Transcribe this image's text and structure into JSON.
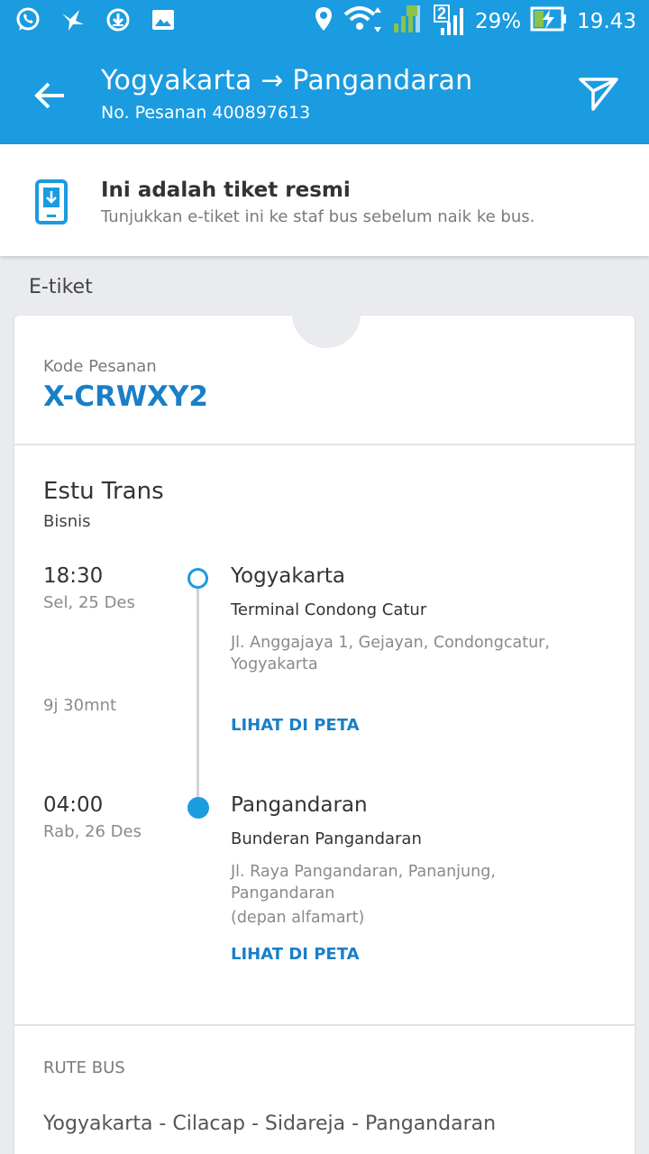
{
  "status_bar": {
    "left_icons": [
      "whatsapp-icon",
      "bird-icon",
      "download-icon",
      "image-icon"
    ],
    "right_icons": [
      "location-icon",
      "wifi-icon",
      "signal-icon"
    ],
    "sim_number": "2",
    "battery": "29%",
    "time": "19.43"
  },
  "header": {
    "title": "Yogyakarta → Pangandaran",
    "order_number": "No. Pesanan 400897613",
    "colors": {
      "primary": "#1b9be0"
    }
  },
  "banner": {
    "title": "Ini adalah tiket resmi",
    "description": "Tunjukkan e-tiket ini ke staf bus sebelum naik ke bus."
  },
  "section_label": "E-tiket",
  "ticket": {
    "booking_code_label": "Kode Pesanan",
    "booking_code": "X-CRWXY2",
    "operator": "Estu Trans",
    "bus_class": "Bisnis",
    "duration": "9j 30mnt",
    "departure": {
      "time": "18:30",
      "date": "Sel, 25 Des",
      "city": "Yogyakarta",
      "terminal": "Terminal Condong Catur",
      "address_line1": "Jl. Anggajaya 1, Gejayan, Condongcatur,",
      "address_line2": "Yogyakarta",
      "map_link": "LIHAT DI PETA"
    },
    "arrival": {
      "time": "04:00",
      "date": "Rab, 26 Des",
      "city": "Pangandaran",
      "terminal": "Bunderan Pangandaran",
      "address_line1": "Jl. Raya Pangandaran, Pananjung,",
      "address_line2": "Pangandaran",
      "address_note": "(depan alfamart)",
      "map_link": "LIHAT DI PETA"
    },
    "route_label": "RUTE BUS",
    "route": "Yogyakarta - Cilacap - Sidareja - Pangandaran"
  }
}
